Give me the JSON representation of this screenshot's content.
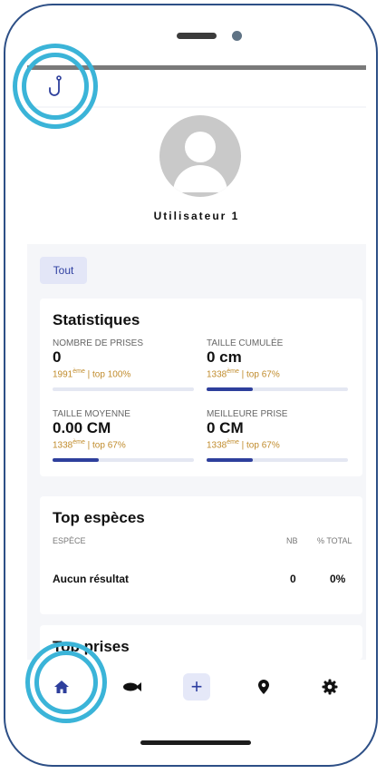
{
  "profile": {
    "username": "Utilisateur 1"
  },
  "filter": {
    "label": "Tout"
  },
  "stats": {
    "title": "Statistiques",
    "items": [
      {
        "label": "NOMBRE DE PRISES",
        "value": "0",
        "rank_num": "1991",
        "rank_sup": "ème",
        "rank_rest": " | top 100%",
        "progress": 0
      },
      {
        "label": "TAILLE CUMULÉE",
        "value": "0 cm",
        "rank_num": "1338",
        "rank_sup": "ème",
        "rank_rest": " | top 67%",
        "progress": 0.33
      },
      {
        "label": "TAILLE MOYENNE",
        "value": "0.00 CM",
        "rank_num": "1338",
        "rank_sup": "ème",
        "rank_rest": " | top 67%",
        "progress": 0.33
      },
      {
        "label": "MEILLEURE PRISE",
        "value": "0 CM",
        "rank_num": "1338",
        "rank_sup": "ème",
        "rank_rest": " | top 67%",
        "progress": 0.33
      }
    ]
  },
  "species": {
    "title": "Top espèces",
    "col_species": "ESPÈCE",
    "col_nb": "NB",
    "col_total": "% TOTAL",
    "empty_label": "Aucun résultat",
    "empty_nb": "0",
    "empty_total": "0%"
  },
  "catches": {
    "title": "Top prises"
  },
  "nav": {
    "items": [
      "home-icon",
      "fish-icon",
      "add-icon",
      "map-pin-icon",
      "settings-icon"
    ],
    "add_symbol": "+"
  },
  "colors": {
    "accent": "#2e3f9c",
    "rank": "#c08b2b",
    "highlight": "#3bb4d8",
    "frame": "#2d4f86"
  }
}
